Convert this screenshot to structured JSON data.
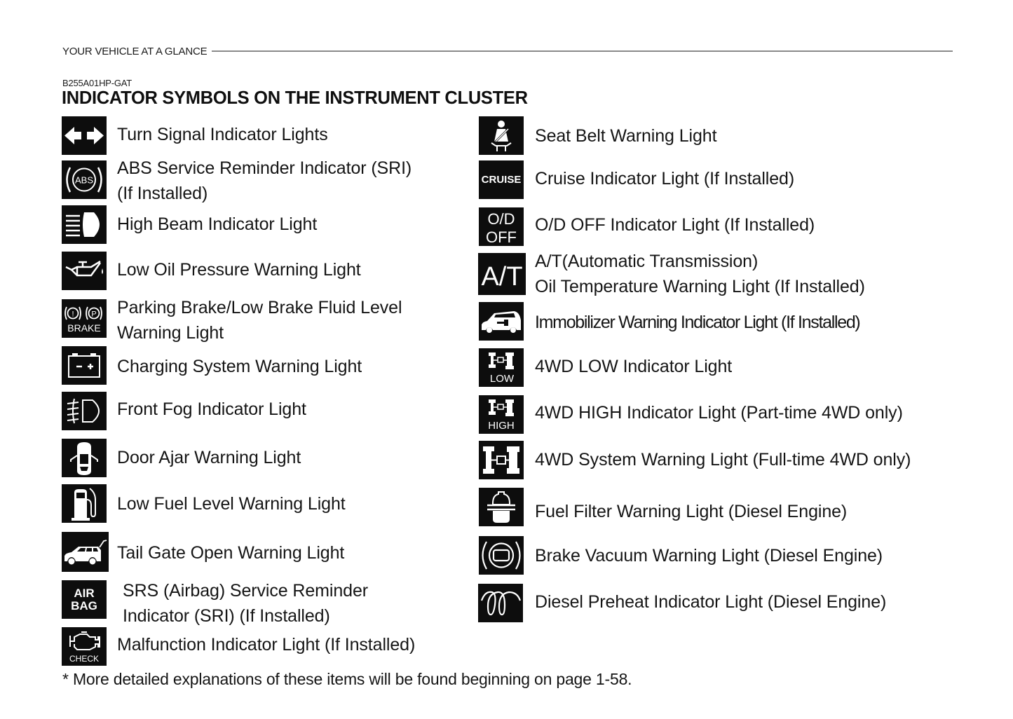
{
  "header": {
    "section_title": "YOUR VEHICLE AT A GLANCE"
  },
  "document": {
    "code": "B255A01HP-GAT",
    "title": "INDICATOR SYMBOLS ON THE INSTRUMENT CLUSTER",
    "footnote": "* More detailed explanations of these items will be found beginning on page 1-58."
  },
  "left_column": [
    {
      "icon": "turn-signal-icon",
      "lines": [
        "Turn Signal Indicator Lights"
      ]
    },
    {
      "icon": "abs-icon",
      "icon_text": "ABS",
      "lines": [
        "ABS Service Reminder Indicator (SRI)",
        "(If Installed)"
      ]
    },
    {
      "icon": "high-beam-icon",
      "lines": [
        "High Beam Indicator Light"
      ]
    },
    {
      "icon": "oil-can-icon",
      "lines": [
        "Low Oil Pressure Warning Light"
      ]
    },
    {
      "icon": "brake-icon",
      "icon_text": "BRAKE",
      "lines": [
        "Parking Brake/Low Brake Fluid Level",
        "Warning Light"
      ]
    },
    {
      "icon": "battery-icon",
      "lines": [
        "Charging System Warning Light"
      ]
    },
    {
      "icon": "front-fog-icon",
      "lines": [
        "Front Fog Indicator Light"
      ]
    },
    {
      "icon": "door-ajar-icon",
      "lines": [
        "Door Ajar Warning Light"
      ]
    },
    {
      "icon": "fuel-pump-icon",
      "lines": [
        "Low Fuel Level Warning Light"
      ]
    },
    {
      "icon": "tail-gate-icon",
      "lines": [
        "Tail Gate Open Warning Light"
      ]
    },
    {
      "icon": "airbag-icon",
      "icon_text": [
        "AIR",
        "BAG"
      ],
      "lines": [
        "SRS (Airbag) Service Reminder",
        "Indicator (SRI) (If Installed)"
      ]
    },
    {
      "icon": "check-engine-icon",
      "icon_text": "CHECK",
      "lines": [
        "Malfunction Indicator Light  (If Installed)"
      ]
    }
  ],
  "right_column": [
    {
      "icon": "seat-belt-icon",
      "lines": [
        "Seat Belt Warning Light"
      ]
    },
    {
      "icon": "cruise-icon",
      "icon_text": "CRUISE",
      "lines": [
        "Cruise Indicator Light (If Installed)"
      ]
    },
    {
      "icon": "od-off-icon",
      "icon_text": [
        "O/D",
        "OFF"
      ],
      "lines": [
        "O/D OFF Indicator Light (If Installed)"
      ]
    },
    {
      "icon": "at-icon",
      "icon_text": "A/T",
      "lines": [
        "A/T(Automatic Transmission)",
        "Oil Temperature Warning Light (If Installed)"
      ]
    },
    {
      "icon": "immobilizer-icon",
      "lines": [
        "Immobilizer Warning Indicator Light (If Installed)"
      ]
    },
    {
      "icon": "4wd-low-icon",
      "icon_text": "LOW",
      "lines": [
        "4WD LOW Indicator Light"
      ]
    },
    {
      "icon": "4wd-high-icon",
      "icon_text": "HIGH",
      "lines": [
        "4WD HIGH Indicator Light (Part-time 4WD only)"
      ]
    },
    {
      "icon": "4wd-system-icon",
      "lines": [
        "4WD  System Warning Light (Full-time 4WD only)"
      ]
    },
    {
      "icon": "fuel-filter-icon",
      "lines": [
        "Fuel Filter Warning Light (Diesel Engine)"
      ]
    },
    {
      "icon": "brake-vacuum-icon",
      "lines": [
        "Brake Vacuum Warning Light (Diesel Engine)"
      ]
    },
    {
      "icon": "diesel-preheat-icon",
      "lines": [
        "Diesel Preheat Indicator Light (Diesel Engine)"
      ]
    }
  ]
}
